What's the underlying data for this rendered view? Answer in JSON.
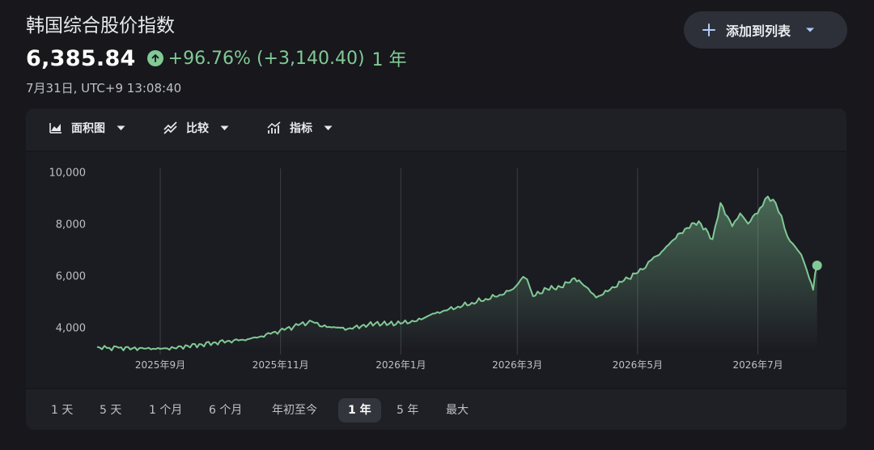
{
  "header": {
    "title": "韩国综合股价指数",
    "price": "6,385.84",
    "change": "+96.76% (+3,140.40)",
    "period": "1 年",
    "timestamp": "7月31日, UTC+9 13:08:40"
  },
  "add_button": {
    "label": "添加到列表"
  },
  "toolbar": {
    "items": [
      {
        "label": "面积图",
        "icon": "area-chart-icon"
      },
      {
        "label": "比较",
        "icon": "compare-icon"
      },
      {
        "label": "指标",
        "icon": "indicators-icon"
      }
    ]
  },
  "ranges": {
    "items": [
      "1 天",
      "5 天",
      "1 个月",
      "6 个月",
      "年初至今",
      "1 年",
      "5 年",
      "最大"
    ],
    "selected": "1 年"
  },
  "colors": {
    "accent_green": "#81c995",
    "background": "#17171c",
    "panel": "#1b1b22"
  },
  "chart_data": {
    "type": "area",
    "y_ticks": [
      4000,
      6000,
      8000,
      10000
    ],
    "y_tick_labels": [
      "4,000",
      "6,000",
      "8,000",
      "10,000"
    ],
    "ylim": [
      3200,
      10200
    ],
    "x_ticks": [
      "2025-09-01",
      "2025-11-01",
      "2026-01-01",
      "2026-03-01",
      "2026-05-01",
      "2026-07-01"
    ],
    "x_tick_labels": [
      "2025年9月",
      "2025年11月",
      "2026年1月",
      "2026年3月",
      "2026年5月",
      "2026年7月"
    ],
    "xlim": [
      "2025-07-31",
      "2026-08-03"
    ],
    "grid": "vertical",
    "last_value": 6385.84,
    "series": [
      {
        "values": [
          [
            "2025-07-31",
            3245
          ],
          [
            "2025-08-05",
            3200
          ],
          [
            "2025-08-11",
            3210
          ],
          [
            "2025-08-18",
            3190
          ],
          [
            "2025-08-25",
            3180
          ],
          [
            "2025-09-01",
            3170
          ],
          [
            "2025-09-08",
            3200
          ],
          [
            "2025-09-15",
            3280
          ],
          [
            "2025-09-22",
            3340
          ],
          [
            "2025-09-29",
            3420
          ],
          [
            "2025-10-06",
            3480
          ],
          [
            "2025-10-13",
            3520
          ],
          [
            "2025-10-20",
            3600
          ],
          [
            "2025-10-27",
            3750
          ],
          [
            "2025-11-03",
            3900
          ],
          [
            "2025-11-10",
            4080
          ],
          [
            "2025-11-17",
            4220
          ],
          [
            "2025-11-21",
            4040
          ],
          [
            "2025-11-28",
            4010
          ],
          [
            "2025-12-05",
            3940
          ],
          [
            "2025-12-12",
            4050
          ],
          [
            "2025-12-19",
            4150
          ],
          [
            "2025-12-26",
            4130
          ],
          [
            "2026-01-02",
            4170
          ],
          [
            "2026-01-09",
            4240
          ],
          [
            "2026-01-16",
            4480
          ],
          [
            "2026-01-23",
            4650
          ],
          [
            "2026-01-30",
            4800
          ],
          [
            "2026-02-06",
            4950
          ],
          [
            "2026-02-13",
            5100
          ],
          [
            "2026-02-20",
            5250
          ],
          [
            "2026-02-27",
            5480
          ],
          [
            "2026-03-04",
            5950
          ],
          [
            "2026-03-06",
            5850
          ],
          [
            "2026-03-09",
            5200
          ],
          [
            "2026-03-16",
            5480
          ],
          [
            "2026-03-23",
            5550
          ],
          [
            "2026-03-30",
            5900
          ],
          [
            "2026-04-06",
            5500
          ],
          [
            "2026-04-10",
            5150
          ],
          [
            "2026-04-17",
            5450
          ],
          [
            "2026-04-24",
            5800
          ],
          [
            "2026-05-01",
            6100
          ],
          [
            "2026-05-05",
            6300
          ],
          [
            "2026-05-08",
            6600
          ],
          [
            "2026-05-12",
            6800
          ],
          [
            "2026-05-18",
            7300
          ],
          [
            "2026-05-25",
            7800
          ],
          [
            "2026-06-01",
            8100
          ],
          [
            "2026-06-08",
            7400
          ],
          [
            "2026-06-12",
            8800
          ],
          [
            "2026-06-18",
            7900
          ],
          [
            "2026-06-22",
            8400
          ],
          [
            "2026-06-26",
            8000
          ],
          [
            "2026-07-02",
            8600
          ],
          [
            "2026-07-06",
            9050
          ],
          [
            "2026-07-10",
            8800
          ],
          [
            "2026-07-13",
            8300
          ],
          [
            "2026-07-16",
            7500
          ],
          [
            "2026-07-20",
            7100
          ],
          [
            "2026-07-23",
            6800
          ],
          [
            "2026-07-27",
            5900
          ],
          [
            "2026-07-29",
            5450
          ],
          [
            "2026-07-30",
            6100
          ],
          [
            "2026-07-31",
            6385.84
          ]
        ]
      }
    ]
  }
}
